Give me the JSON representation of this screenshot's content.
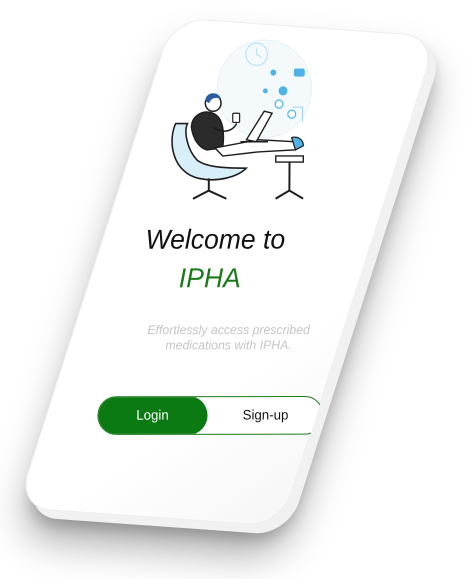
{
  "welcome": {
    "title": "Welcome to",
    "brand": "IPHA",
    "subtitle": "Effortlessly access prescribed medications with IPHA."
  },
  "auth_toggle": {
    "login_label": "Login",
    "signup_label": "Sign-up",
    "selected": "Login"
  },
  "colors": {
    "brand_green": "#0b7a12",
    "accent_blue": "#4fb3e8",
    "chair_blue": "#d8eef8",
    "subtitle_gray": "#c6c6c6"
  },
  "icons": [
    "person-at-laptop-illustration"
  ]
}
